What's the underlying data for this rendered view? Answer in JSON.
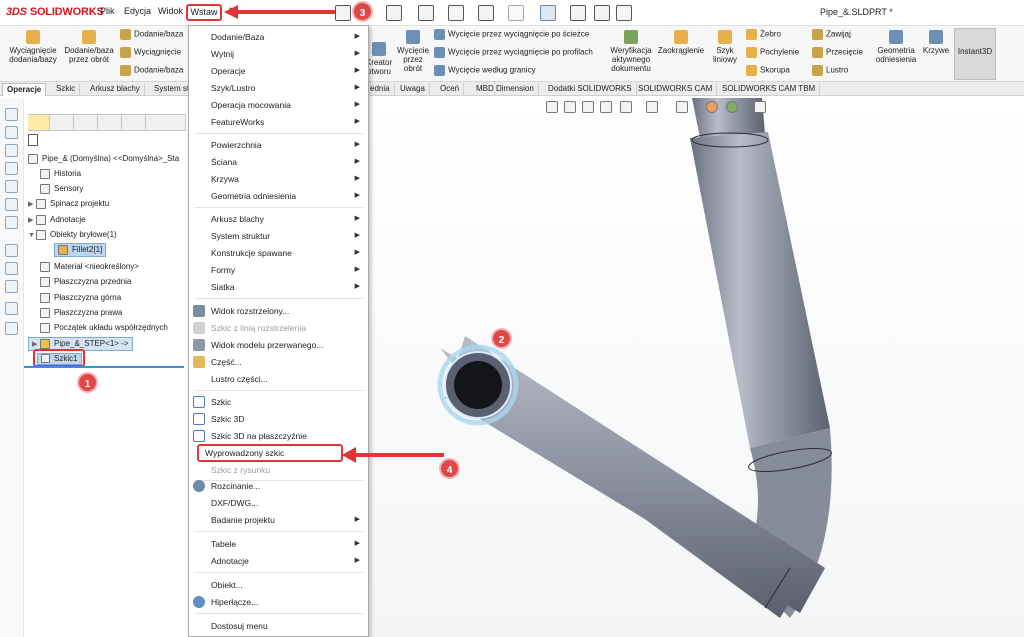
{
  "app": {
    "name": "SOLIDWORKS",
    "doc_title": "Pipe_&.SLDPRT *"
  },
  "menubar": {
    "items": [
      "Plik",
      "Edycja",
      "Widok",
      "Wstaw",
      "N"
    ]
  },
  "ribbon": {
    "left_buttons": [
      {
        "label": "Wyciągnięcie dodania/bazy"
      },
      {
        "label": "Dodanie/baza przez obrót"
      }
    ],
    "small_col1": [
      "Dodanie/baza",
      "Wyciągnięcie",
      "Dodanie/baza"
    ],
    "right_buttons": [
      {
        "label": "Kreator otworu"
      },
      {
        "label": "Wycięcie przez obrót"
      }
    ],
    "cut_items": [
      "Wycięcie przez wyciągnięcie po ścieżce",
      "Wycięcie przez wyciągnięcie po profilach",
      "Wycięcie według granicy"
    ],
    "feature_buttons": [
      {
        "label": "Weryfikacja aktywnego dokumentu"
      },
      {
        "label": "Zaokrąglenie"
      },
      {
        "label": "Szyk liniowy"
      }
    ],
    "small_col2": [
      "Żebro",
      "Pochylenie",
      "Skorupa"
    ],
    "small_col3": [
      "Zawijaj",
      "Przecięcie",
      "Lustro"
    ],
    "end_buttons": [
      {
        "label": "Geometria odniesienia"
      },
      {
        "label": "Krzywe"
      },
      {
        "label": "Instant3D"
      }
    ]
  },
  "tabs": [
    "Operacje",
    "Szkic",
    "Arkusz blachy",
    "System st",
    "ednia",
    "Uwaga",
    "Oceń",
    "MBD Dimension",
    "Dodatki SOLIDWORKS",
    "SOLIDWORKS CAM",
    "SOLIDWORKS CAM TBM"
  ],
  "tree": {
    "root": "Pipe_& (Domyślna) <<Domyślna>_Sta",
    "nodes": [
      "Historia",
      "Sensory",
      "Spinacz projektu",
      "Adnotacje",
      "Obiekty bryłowe(1)",
      "Fillet2[1]",
      "Materiał <nieokreślony>",
      "Płaszczyzna przednia",
      "Płaszczyzna górna",
      "Płaszczyzna prawa",
      "Początek układu współrzędnych",
      "Pipe_&_STEP<1> ->",
      "Szkic1"
    ]
  },
  "menu": {
    "items": [
      {
        "label": "Dodanie/Baza",
        "sub": true
      },
      {
        "label": "Wytnij",
        "sub": true
      },
      {
        "label": "Operacje",
        "sub": true
      },
      {
        "label": "Szyk/Lustro",
        "sub": true
      },
      {
        "label": "Operacja mocowania",
        "sub": true
      },
      {
        "label": "FeatureWorks",
        "sub": true
      },
      {
        "label": "Powierzchnia",
        "sub": true
      },
      {
        "label": "Ściana",
        "sub": true
      },
      {
        "label": "Krzywa",
        "sub": true
      },
      {
        "label": "Geometria odniesienia",
        "sub": true
      },
      {
        "label": "Arkusz blachy",
        "sub": true
      },
      {
        "label": "System struktur",
        "sub": true
      },
      {
        "label": "Konstrukcje spawane",
        "sub": true
      },
      {
        "label": "Formy",
        "sub": true
      },
      {
        "label": "Siatka",
        "sub": true
      },
      {
        "label": "Widok rozstrzelony...",
        "sub": false
      },
      {
        "label": "Szkic z linią rozstrzelenia",
        "sub": false,
        "disabled": true
      },
      {
        "label": "Widok modelu przerwanego...",
        "sub": false
      },
      {
        "label": "Część...",
        "sub": false
      },
      {
        "label": "Lustro części...",
        "sub": false
      },
      {
        "label": "Szkic",
        "sub": false
      },
      {
        "label": "Szkic 3D",
        "sub": false
      },
      {
        "label": "Szkic 3D na płaszczyźnie",
        "sub": false
      },
      {
        "label": "Wyprowadzony szkic",
        "sub": false
      },
      {
        "label": "Szkic z rysunku",
        "sub": false,
        "disabled": true
      },
      {
        "label": "Rozcinanie...",
        "sub": false
      },
      {
        "label": "DXF/DWG...",
        "sub": false
      },
      {
        "label": "Badanie projektu",
        "sub": true
      },
      {
        "label": "Tabele",
        "sub": true
      },
      {
        "label": "Adnotacje",
        "sub": true
      },
      {
        "label": "Obiekt...",
        "sub": false
      },
      {
        "label": "Hiperłącze...",
        "sub": false
      },
      {
        "label": "Dostosuj menu",
        "sub": false
      }
    ]
  },
  "callouts": [
    "1",
    "2",
    "3",
    "4"
  ],
  "colors": {
    "accent_red": "#e23434",
    "badge_red": "#e04848",
    "selection_blue": "#bcd6ef",
    "pipe": "#8f95a6"
  }
}
